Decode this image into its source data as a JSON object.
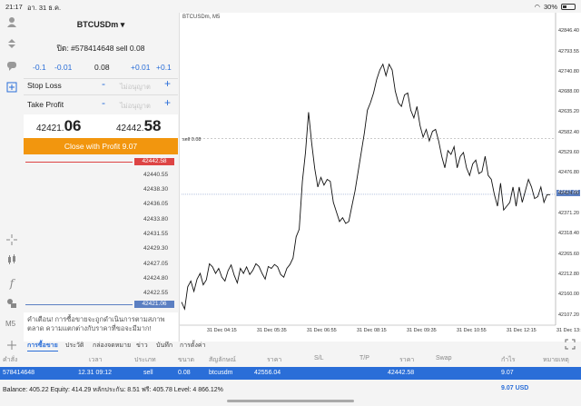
{
  "status_bar": {
    "time": "21:17",
    "date": "อา. 31 ธ.ค.",
    "battery": "30%"
  },
  "symbol": {
    "name": "BTCUSDm",
    "caret": "▾"
  },
  "order": {
    "line": "ปิด: #578414648 sell 0.08",
    "steps": [
      "-0.1",
      "-0.01",
      "0.08",
      "+0.01",
      "+0.1"
    ],
    "stop_loss_label": "Stop Loss",
    "take_profit_label": "Take Profit",
    "sl_placeholder": "ไม่อนุญาต",
    "tp_placeholder": "ไม่อนุญาต",
    "minus": "-",
    "plus": "+"
  },
  "prices": {
    "bid_main": "42421.",
    "bid_big": "06",
    "ask_main": "42442.",
    "ask_big": "58"
  },
  "close_button": "Close with Profit 9.07",
  "mini_chart": {
    "ask_tag": "42442.58",
    "bid_tag": "42421.06",
    "levels": [
      "42440.55",
      "42438.30",
      "42436.05",
      "42433.80",
      "42431.55",
      "42429.30",
      "42427.05",
      "42424.80",
      "42422.55"
    ]
  },
  "warning": "คำเตือน! การซื้อขายจะถูกดำเนินการตามสภาพตลาด ความแตกต่างกับราคาที่ขอจะมีมาก!",
  "chart": {
    "title": "BTCUSDm, M5",
    "sell_label": "sell 0.08",
    "current_tag": "42421.06",
    "y_labels": [
      "42846.40",
      "42793.55",
      "42740.80",
      "42688.00",
      "42635.20",
      "42582.40",
      "42529.60",
      "42476.80",
      "42424.00",
      "42371.20",
      "42318.40",
      "42265.60",
      "42212.80",
      "42160.00",
      "42107.20"
    ],
    "x_labels": [
      "31 Dec 04:15",
      "31 Dec 05:35",
      "31 Dec 06:55",
      "31 Dec 08:15",
      "31 Dec 09:35",
      "31 Dec 10:55",
      "31 Dec 12:15",
      "31 Dec 13:35"
    ]
  },
  "chart_data": {
    "type": "line",
    "title": "BTCUSDm, M5",
    "x": [
      "31 Dec 04:15",
      "31 Dec 05:35",
      "31 Dec 06:55",
      "31 Dec 08:15",
      "31 Dec 09:35",
      "31 Dec 10:55",
      "31 Dec 12:15",
      "31 Dec 13:35"
    ],
    "series": [
      {
        "values": [
          42140,
          42122,
          42180,
          42195,
          42168,
          42200,
          42215,
          42185,
          42198,
          42240,
          42232,
          42215,
          42228,
          42205,
          42195,
          42222,
          42237,
          42210,
          42190,
          42228,
          42215,
          42232,
          42212,
          42223,
          42240,
          42233,
          42215,
          42200,
          42233,
          42228,
          42238,
          42232,
          42212,
          42205,
          42228,
          42238,
          42255,
          42310,
          42330,
          42455,
          42530,
          42635,
          42555,
          42488,
          42440,
          42465,
          42445,
          42460,
          42455,
          42400,
          42375,
          42350,
          42360,
          42345,
          42350,
          42390,
          42430,
          42480,
          42530,
          42580,
          42640,
          42660,
          42685,
          42720,
          42745,
          42760,
          42730,
          42760,
          42745,
          42690,
          42660,
          42650,
          42680,
          42685,
          42640,
          42620,
          42650,
          42600,
          42570,
          42590,
          42560,
          42585,
          42590,
          42560,
          42520,
          42490,
          42535,
          42525,
          42545,
          42490,
          42520,
          42530,
          42490,
          42470,
          42500,
          42510,
          42475,
          42480,
          42520,
          42470,
          42460,
          42420,
          42390,
          42450,
          42380,
          42390,
          42400,
          42440,
          42390,
          42440,
          42400,
          42430,
          42460,
          42440,
          42410,
          42415,
          42440,
          42400,
          42420,
          42420
        ]
      }
    ],
    "y_range": [
      42080,
      42880
    ],
    "reference_lines": [
      42566,
      42421
    ]
  },
  "tabs": [
    "การซื้อขาย",
    "ประวัติ",
    "กล่องจดหมาย",
    "ข่าว",
    "บันทึก",
    "การตั้งค่า"
  ],
  "table": {
    "headers": [
      "คำสั่ง",
      "เวลา",
      "ประเภท",
      "ขนาด",
      "สัญลักษณ์",
      "ราคา",
      "S/L",
      "T/P",
      "ราคา",
      "Swap",
      "กำไร",
      "หมายเหตุ"
    ],
    "row": [
      "578414648",
      "12.31 09:12",
      "sell",
      "0.08",
      "btcusdm",
      "42556.04",
      "",
      "",
      "42442.58",
      "",
      "9.07",
      ""
    ]
  },
  "balance": {
    "text": "Balance: 405.22 Equity: 414.29 หลักประกัน: 8.51 ฟรี: 405.78 Level: 4 866.12%",
    "profit": "9.07  USD"
  }
}
